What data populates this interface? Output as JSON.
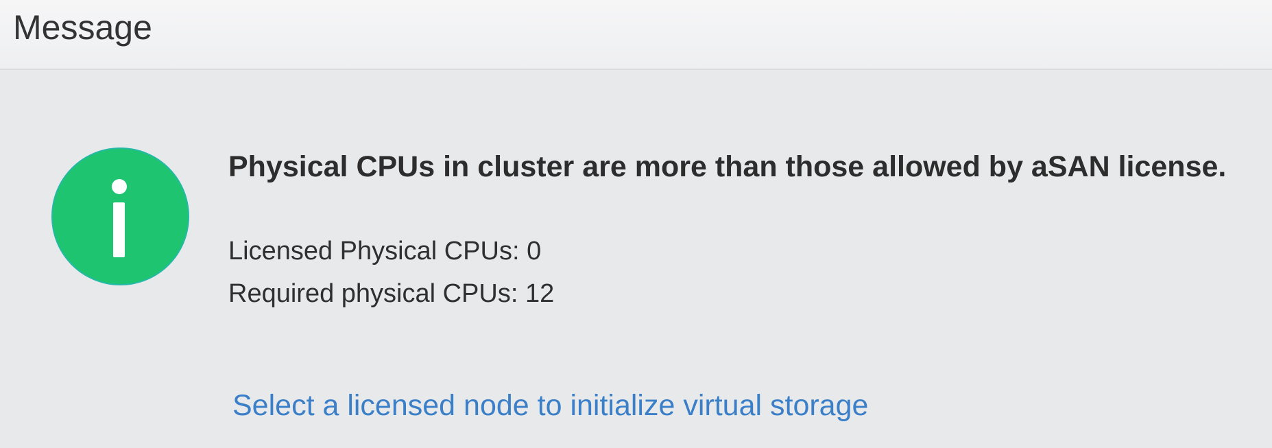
{
  "dialog": {
    "title": "Message"
  },
  "message": {
    "icon": "info-icon",
    "icon_color": "#1fc471",
    "headline": "Physical CPUs in cluster are more than those allowed by aSAN license.",
    "licensed_cpus": "Licensed Physical CPUs: 0",
    "required_cpus": "Required physical CPUs: 12"
  },
  "action": {
    "link_text": "Select a licensed node to initialize virtual storage",
    "link_color": "#3a7fc7"
  }
}
